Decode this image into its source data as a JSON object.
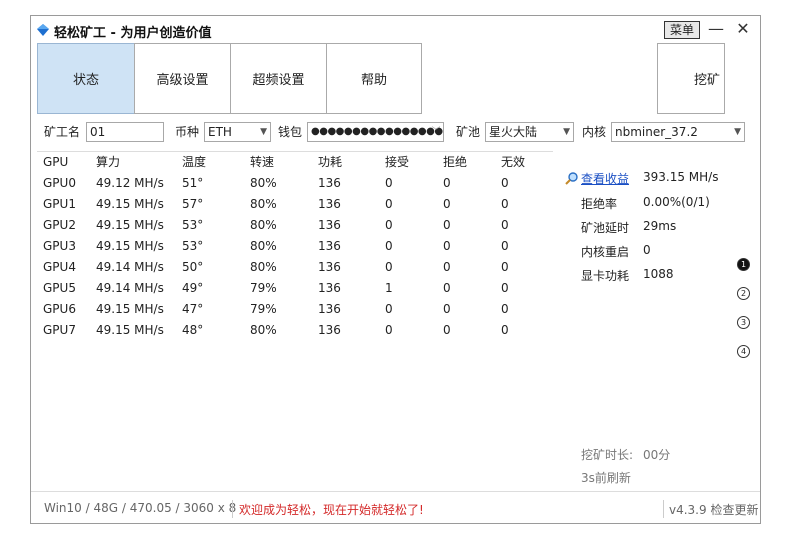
{
  "window": {
    "title": "轻松矿工 - 为用户创造价值",
    "menu_label": "菜单",
    "minimize_label": "—",
    "close_label": "✕"
  },
  "tabs": [
    {
      "label": "状态",
      "active": true
    },
    {
      "label": "高级设置",
      "active": false
    },
    {
      "label": "超频设置",
      "active": false
    },
    {
      "label": "帮助",
      "active": false
    }
  ],
  "mine_button": "挖矿",
  "config": {
    "worker_label": "矿工名",
    "worker_value": "01",
    "coin_label": "币种",
    "coin_value": "ETH",
    "wallet_label": "钱包",
    "wallet_value": "●●●●●●●●●●●●●●●●",
    "pool_label": "矿池",
    "pool_value": "星火大陆",
    "kernel_label": "内核",
    "kernel_value": "nbminer_37.2"
  },
  "table": {
    "headers": [
      "GPU",
      "算力",
      "温度",
      "转速",
      "功耗",
      "接受",
      "拒绝",
      "无效"
    ],
    "rows": [
      [
        "GPU0",
        "49.12 MH/s",
        "51°",
        "80%",
        "136",
        "0",
        "0",
        "0"
      ],
      [
        "GPU1",
        "49.15 MH/s",
        "57°",
        "80%",
        "136",
        "0",
        "0",
        "0"
      ],
      [
        "GPU2",
        "49.15 MH/s",
        "53°",
        "80%",
        "136",
        "0",
        "0",
        "0"
      ],
      [
        "GPU3",
        "49.15 MH/s",
        "53°",
        "80%",
        "136",
        "0",
        "0",
        "0"
      ],
      [
        "GPU4",
        "49.14 MH/s",
        "50°",
        "80%",
        "136",
        "0",
        "0",
        "0"
      ],
      [
        "GPU5",
        "49.14 MH/s",
        "49°",
        "79%",
        "136",
        "1",
        "0",
        "0"
      ],
      [
        "GPU6",
        "49.15 MH/s",
        "47°",
        "79%",
        "136",
        "0",
        "0",
        "0"
      ],
      [
        "GPU7",
        "49.15 MH/s",
        "48°",
        "80%",
        "136",
        "0",
        "0",
        "0"
      ]
    ]
  },
  "stats": {
    "view_earnings": "查看收益",
    "total_hashrate": "393.15 MH/s",
    "reject_label": "拒绝率",
    "reject_value": "0.00%(0/1)",
    "latency_label": "矿池延时",
    "latency_value": "29ms",
    "restart_label": "内核重启",
    "restart_value": "0",
    "power_label": "显卡功耗",
    "power_value": "1088",
    "mining_time_label": "挖矿时长:",
    "mining_time_value": "00分",
    "refresh_text": "3s前刷新"
  },
  "pages": [
    "1",
    "2",
    "3",
    "4"
  ],
  "statusbar": {
    "system": "Win10  / 48G / 470.05 / 3060 x 8",
    "message": "欢迎成为轻松，现在开始就轻松了!",
    "version": "v4.3.9 检查更新"
  },
  "colors": {
    "accent": "#1a4fc4",
    "tab_active": "#cfe3f5",
    "message": "#d42a2a"
  }
}
